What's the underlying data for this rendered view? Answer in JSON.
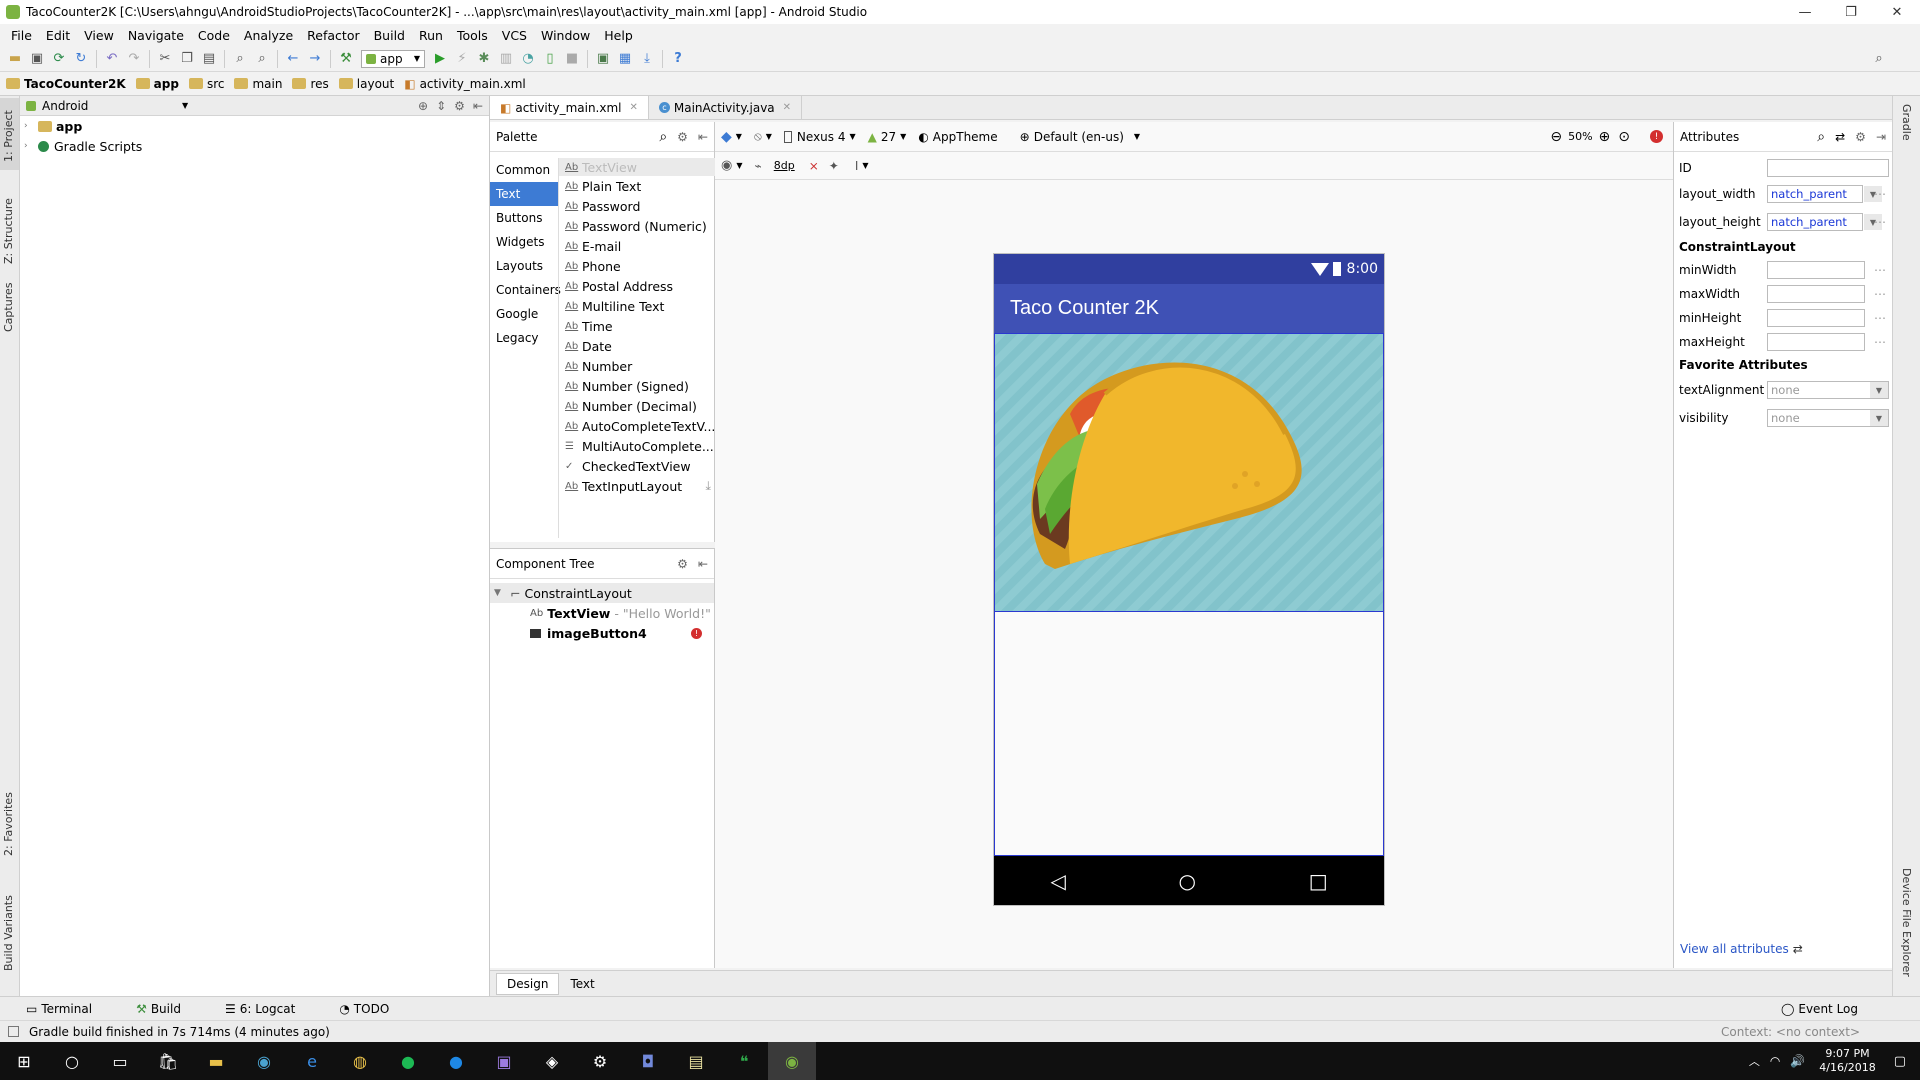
{
  "window": {
    "title": "TacoCounter2K [C:\\Users\\ahngu\\AndroidStudioProjects\\TacoCounter2K] - ...\\app\\src\\main\\res\\layout\\activity_main.xml [app] - Android Studio",
    "controls": {
      "minimize": "—",
      "restore": "❐",
      "close": "✕"
    }
  },
  "menu": [
    "File",
    "Edit",
    "View",
    "Navigate",
    "Code",
    "Analyze",
    "Refactor",
    "Build",
    "Run",
    "Tools",
    "VCS",
    "Window",
    "Help"
  ],
  "toolbar": {
    "run_config": "app"
  },
  "breadcrumbs": [
    "TacoCounter2K",
    "app",
    "src",
    "main",
    "res",
    "layout",
    "activity_main.xml"
  ],
  "left_strip": {
    "project": "1: Project",
    "structure": "Z: Structure",
    "captures": "Captures",
    "favorites": "2: Favorites",
    "build_variants": "Build Variants"
  },
  "right_strip": {
    "gradle": "Gradle",
    "device_explorer": "Device File Explorer"
  },
  "project_panel": {
    "view_mode": "Android",
    "items": [
      {
        "label": "app"
      },
      {
        "label": "Gradle Scripts"
      }
    ]
  },
  "editor_tabs": [
    {
      "label": "activity_main.xml",
      "active": true
    },
    {
      "label": "MainActivity.java",
      "active": false
    }
  ],
  "palette": {
    "title": "Palette",
    "categories": [
      "Common",
      "Text",
      "Buttons",
      "Widgets",
      "Layouts",
      "Containers",
      "Google",
      "Legacy"
    ],
    "selected_category": "Text",
    "header_item": "TextView",
    "items": [
      "Plain Text",
      "Password",
      "Password (Numeric)",
      "E-mail",
      "Phone",
      "Postal Address",
      "Multiline Text",
      "Time",
      "Date",
      "Number",
      "Number (Signed)",
      "Number (Decimal)",
      "AutoCompleteTextV...",
      "MultiAutoComplete...",
      "CheckedTextView",
      "TextInputLayout"
    ]
  },
  "component_tree": {
    "title": "Component Tree",
    "root": "ConstraintLayout",
    "children": [
      {
        "label": "TextView",
        "detail": "- \"Hello World!\""
      },
      {
        "label": "imageButton4",
        "error": true
      }
    ]
  },
  "design_toolbar": {
    "device": "Nexus 4",
    "api": "27",
    "theme": "AppTheme",
    "locale": "Default (en-us)",
    "zoom": "50%",
    "margin": "8dp"
  },
  "phone": {
    "time": "8:00",
    "app_title": "Taco Counter 2K",
    "colors": {
      "status": "#303f9f",
      "appbar": "#3f51b5",
      "background": "#8ecbd2"
    }
  },
  "bottom_tabs": [
    {
      "label": "Design",
      "active": true
    },
    {
      "label": "Text",
      "active": false
    }
  ],
  "attributes": {
    "title": "Attributes",
    "id_label": "ID",
    "id_value": "",
    "layout_width_label": "layout_width",
    "layout_width_value": "natch_parent",
    "layout_height_label": "layout_height",
    "layout_height_value": "natch_parent",
    "section_constraint": "ConstraintLayout",
    "min_width": "minWidth",
    "max_width": "maxWidth",
    "min_height": "minHeight",
    "max_height": "maxHeight",
    "section_favorite": "Favorite Attributes",
    "text_alignment_label": "textAlignment",
    "text_alignment_value": "none",
    "visibility_label": "visibility",
    "visibility_value": "none",
    "view_all": "View all attributes"
  },
  "tool_windows": [
    "Terminal",
    "Build",
    "6: Logcat",
    "TODO"
  ],
  "event_log": "Event Log",
  "status": {
    "message": "Gradle build finished in 7s 714ms (4 minutes ago)",
    "context": "Context: <no context>"
  },
  "taskbar": {
    "time": "9:07 PM",
    "date": "4/16/2018"
  }
}
